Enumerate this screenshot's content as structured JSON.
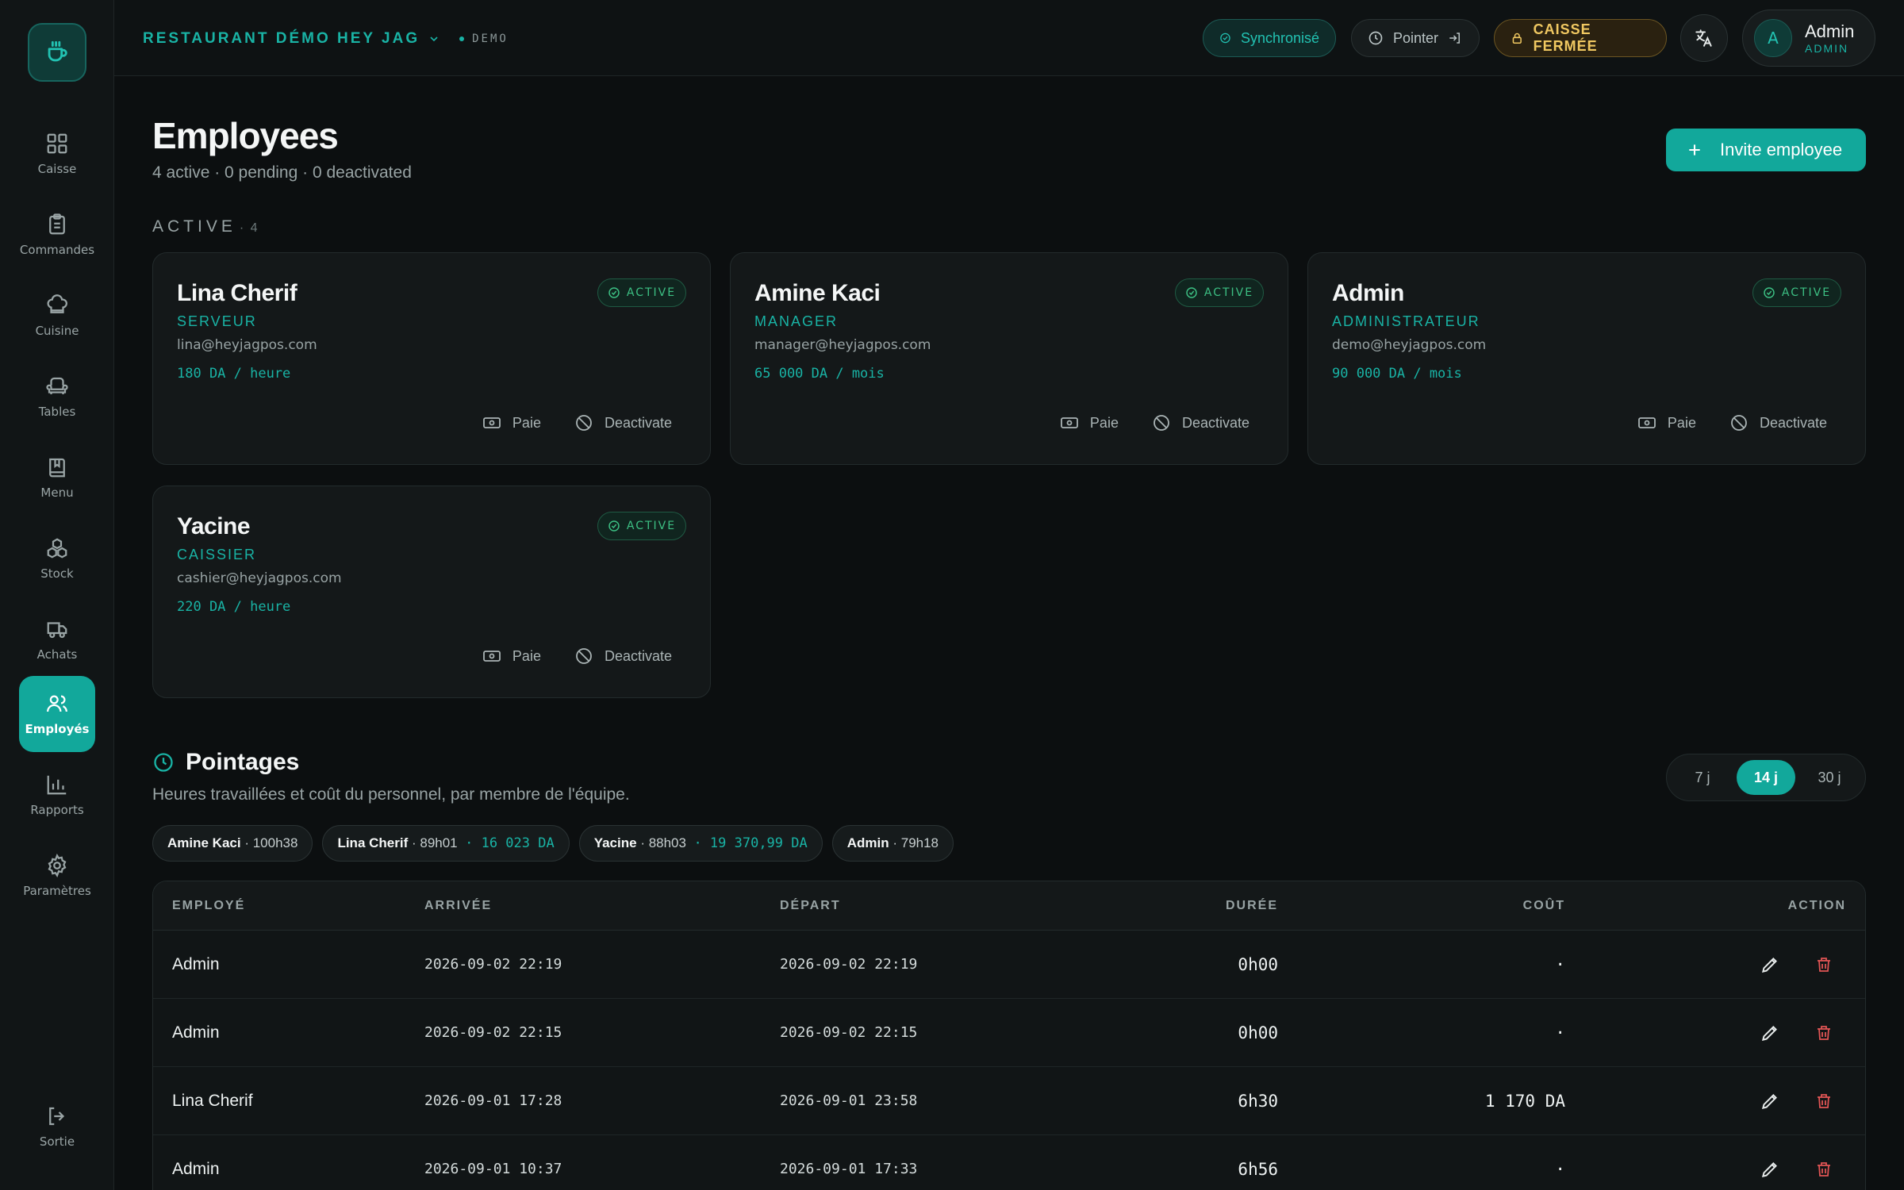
{
  "sidebar": {
    "items": [
      {
        "label": "Caisse",
        "icon": "grid-icon"
      },
      {
        "label": "Commandes",
        "icon": "clipboard-icon"
      },
      {
        "label": "Cuisine",
        "icon": "chef-hat-icon"
      },
      {
        "label": "Tables",
        "icon": "armchair-icon"
      },
      {
        "label": "Menu",
        "icon": "book-icon"
      },
      {
        "label": "Stock",
        "icon": "boxes-icon"
      },
      {
        "label": "Achats",
        "icon": "truck-icon"
      },
      {
        "label": "Employés",
        "icon": "users-icon",
        "active": true
      },
      {
        "label": "Rapports",
        "icon": "bar-chart-icon"
      },
      {
        "label": "Paramètres",
        "icon": "gear-icon"
      }
    ],
    "logout_label": "Sortie"
  },
  "header": {
    "restaurant": "RESTAURANT DÉMO HEY JAG",
    "env_tag": "DEMO",
    "sync_label": "Synchronisé",
    "pointer_label": "Pointer",
    "caisse_label": "CAISSE FERMÉE",
    "user": {
      "initial": "A",
      "name": "Admin",
      "role": "ADMIN"
    }
  },
  "colors": {
    "accent": "#12a89b",
    "warning": "#f0c861",
    "success": "#3cbf83",
    "danger": "#e05454"
  },
  "page": {
    "title": "Employees",
    "subtitle": "4 active · 0 pending · 0 deactivated",
    "invite_label": "Invite employee",
    "active_section": "ACTIVE",
    "active_count": "· 4"
  },
  "employees": [
    {
      "name": "Lina Cherif",
      "role": "SERVEUR",
      "email": "lina@heyjagpos.com",
      "rate": "180 DA / heure",
      "status": "ACTIVE",
      "pay_label": "Paie",
      "deactivate_label": "Deactivate"
    },
    {
      "name": "Amine Kaci",
      "role": "MANAGER",
      "email": "manager@heyjagpos.com",
      "rate": "65 000 DA / mois",
      "status": "ACTIVE",
      "pay_label": "Paie",
      "deactivate_label": "Deactivate"
    },
    {
      "name": "Admin",
      "role": "ADMINISTRATEUR",
      "email": "demo@heyjagpos.com",
      "rate": "90 000 DA / mois",
      "status": "ACTIVE",
      "pay_label": "Paie",
      "deactivate_label": "Deactivate"
    },
    {
      "name": "Yacine",
      "role": "CAISSIER",
      "email": "cashier@heyjagpos.com",
      "rate": "220 DA / heure",
      "status": "ACTIVE",
      "pay_label": "Paie",
      "deactivate_label": "Deactivate"
    }
  ],
  "pointages": {
    "title": "Pointages",
    "subtitle": "Heures travaillées et coût du personnel, par membre de l'équipe.",
    "ranges": [
      "7 j",
      "14 j",
      "30 j"
    ],
    "selected_range": "14 j",
    "summary": [
      {
        "name": "Amine Kaci",
        "hours": "· 100h38",
        "cost": ""
      },
      {
        "name": "Lina Cherif",
        "hours": "· 89h01",
        "cost": "· 16 023 DA"
      },
      {
        "name": "Yacine",
        "hours": "· 88h03",
        "cost": "· 19 370,99 DA"
      },
      {
        "name": "Admin",
        "hours": "· 79h18",
        "cost": ""
      }
    ],
    "columns": [
      "EMPLOYÉ",
      "ARRIVÉE",
      "DÉPART",
      "DURÉE",
      "COÛT",
      "ACTION"
    ],
    "rows": [
      {
        "employee": "Admin",
        "arrival": "2026-09-02 22:19",
        "departure": "2026-09-02 22:19",
        "duration": "0h00",
        "cost": "·"
      },
      {
        "employee": "Admin",
        "arrival": "2026-09-02 22:15",
        "departure": "2026-09-02 22:15",
        "duration": "0h00",
        "cost": "·"
      },
      {
        "employee": "Lina Cherif",
        "arrival": "2026-09-01 17:28",
        "departure": "2026-09-01 23:58",
        "duration": "6h30",
        "cost": "1 170 DA"
      },
      {
        "employee": "Admin",
        "arrival": "2026-09-01 10:37",
        "departure": "2026-09-01 17:33",
        "duration": "6h56",
        "cost": "·"
      }
    ]
  }
}
